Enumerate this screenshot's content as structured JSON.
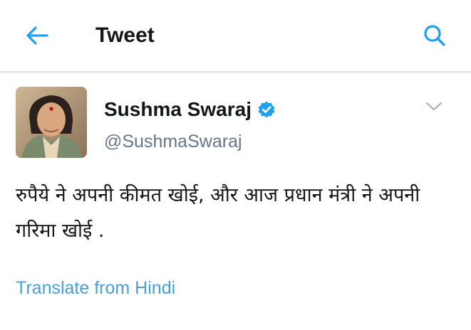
{
  "header": {
    "title": "Tweet",
    "back_icon": "arrow-left-icon",
    "search_icon": "search-icon"
  },
  "tweet": {
    "author_name": "Sushma Swaraj",
    "verified_icon": "verified-badge-icon",
    "handle": "@SushmaSwaraj",
    "menu_icon": "chevron-down-icon",
    "text": "रुपैये ने अपनी कीमत खोई, और आज प्रधान मंत्री ने अपनी गरिमा खोई .",
    "translate_label": "Translate from Hindi"
  },
  "colors": {
    "accent": "#1da1f2",
    "link": "#4a9fd8",
    "muted": "#657786",
    "divider": "#e1e8ed"
  }
}
